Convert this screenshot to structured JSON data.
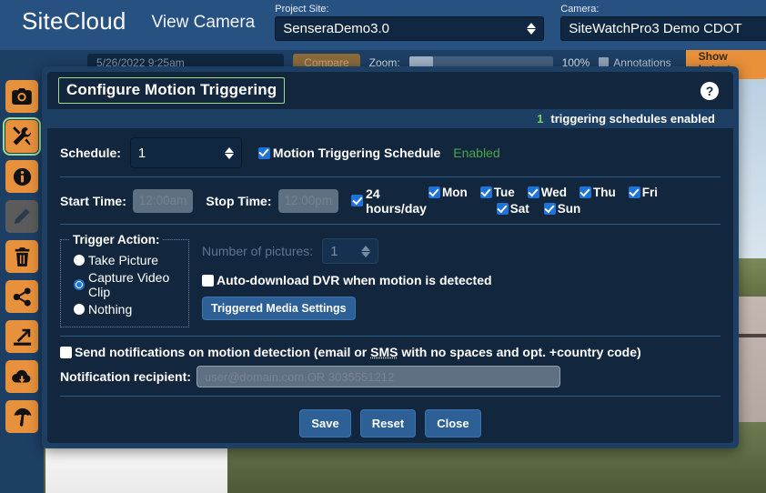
{
  "topbar": {
    "menu_icon": "hamburger-icon",
    "brand": "SiteCloud",
    "page_title": "View Camera",
    "project_site_label": "Project Site:",
    "project_site_value": "SenseraDemo3.0",
    "camera_label": "Camera:",
    "camera_value": "SiteWatchPro3 Demo CDOT"
  },
  "toolbar": {
    "date_value": "5/26/2022  9:25am",
    "compare_label": "Compare",
    "zoom_label": "Zoom:",
    "zoom_percent": "100%",
    "annotations_label": "Annotations",
    "show_latest_label": "Show Latest"
  },
  "rail": {
    "items": [
      {
        "name": "camera-icon",
        "state": "enabled"
      },
      {
        "name": "tools-icon",
        "state": "selected"
      },
      {
        "name": "info-icon",
        "state": "enabled"
      },
      {
        "name": "pencil-icon",
        "state": "disabled"
      },
      {
        "name": "trash-icon",
        "state": "enabled"
      },
      {
        "name": "share-icon",
        "state": "enabled"
      },
      {
        "name": "measure-icon",
        "state": "enabled"
      },
      {
        "name": "cloud-download-icon",
        "state": "enabled"
      },
      {
        "name": "umbrella-icon",
        "state": "enabled"
      }
    ]
  },
  "dialog": {
    "title": "Configure Motion Triggering",
    "help_icon": "question-mark-icon",
    "status_count": "1",
    "status_text": "triggering schedules enabled",
    "schedule_label": "Schedule:",
    "schedule_value": "1",
    "motion_schedule_label": "Motion Triggering Schedule",
    "motion_schedule_checked": true,
    "enabled_tag": "Enabled",
    "start_time_label": "Start Time:",
    "start_time_value": "12:00am",
    "stop_time_label": "Stop Time:",
    "stop_time_value": "12:00pm",
    "all_day_label": "24 hours/day",
    "all_day_checked": true,
    "days": [
      {
        "label": "Mon",
        "checked": true
      },
      {
        "label": "Tue",
        "checked": true
      },
      {
        "label": "Wed",
        "checked": true
      },
      {
        "label": "Thu",
        "checked": true
      },
      {
        "label": "Fri",
        "checked": true
      },
      {
        "label": "Sat",
        "checked": true
      },
      {
        "label": "Sun",
        "checked": true
      }
    ],
    "trigger_action_legend": "Trigger Action:",
    "trigger_options": [
      {
        "label": "Take Picture",
        "selected": false
      },
      {
        "label": "Capture Video Clip",
        "selected": true
      },
      {
        "label": "Nothing",
        "selected": false
      }
    ],
    "num_pictures_label": "Number of pictures:",
    "num_pictures_value": "1",
    "auto_download_label": "Auto-download DVR when motion is detected",
    "auto_download_checked": false,
    "triggered_media_label": "Triggered Media Settings",
    "send_notifications_label_a": "Send notifications on motion detection (email or ",
    "send_notifications_sms": "SMS",
    "send_notifications_label_b": " with no spaces and opt. +country code)",
    "send_notifications_checked": false,
    "notification_recipient_label": "Notification recipient:",
    "notification_placeholder": "user@domain.com OR 3035551212",
    "save_label": "Save",
    "reset_label": "Reset",
    "close_label": "Close"
  },
  "colors": {
    "accent_orange": "#e8913c",
    "selection_green": "#9bdb8d",
    "enabled_green": "#4aa84a",
    "panel_dark": "#12263d",
    "app_blue": "#1d3f63",
    "header_blue": "#265180",
    "checkbox_blue": "#1e73d6"
  }
}
